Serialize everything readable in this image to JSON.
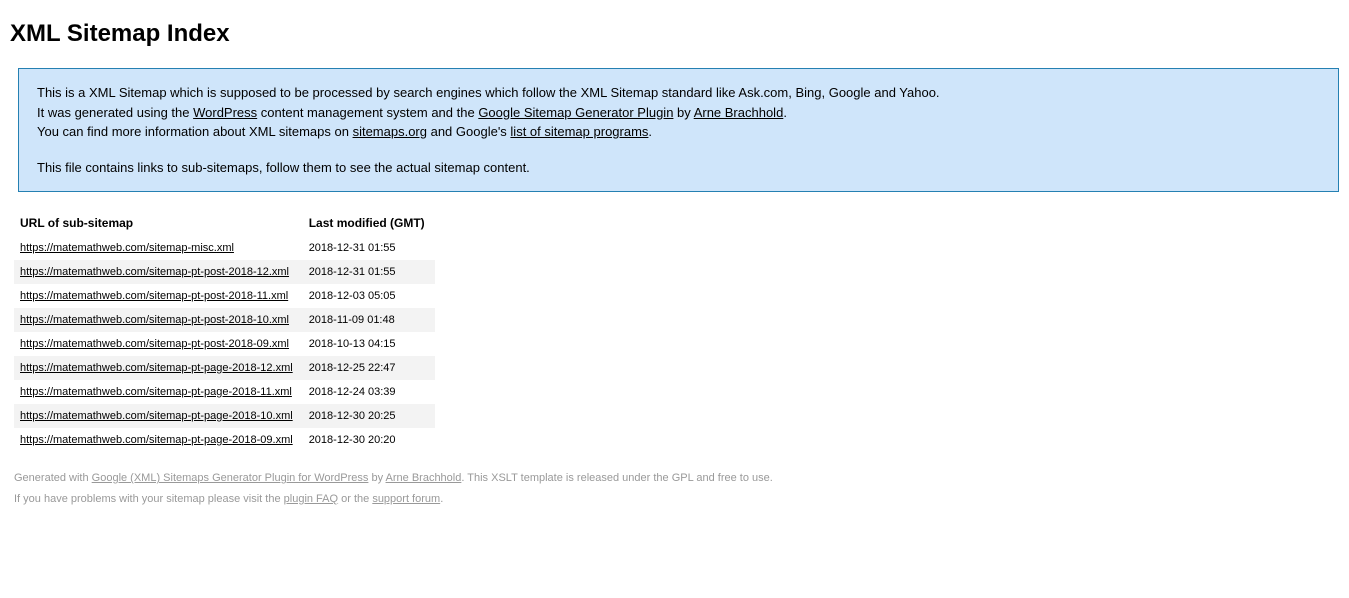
{
  "title": "XML Sitemap Index",
  "info": {
    "line1_pre": "This is a XML Sitemap which is supposed to be processed by search engines which follow the XML Sitemap standard like Ask.com, Bing, Google and Yahoo.",
    "line2_pre": "It was generated using the ",
    "link_wordpress": "WordPress",
    "line2_mid": " content management system and the ",
    "link_plugin": "Google Sitemap Generator Plugin",
    "line2_by": " by ",
    "link_author": "Arne Brachhold",
    "line2_end": ".",
    "line3_pre": "You can find more information about XML sitemaps on ",
    "link_sitemaps": "sitemaps.org",
    "line3_mid": " and Google's ",
    "link_programs": "list of sitemap programs",
    "line3_end": ".",
    "line4": "This file contains links to sub-sitemaps, follow them to see the actual sitemap content."
  },
  "table": {
    "col_url": "URL of sub-sitemap",
    "col_mod": "Last modified (GMT)",
    "rows": [
      {
        "url": "https://matemathweb.com/sitemap-misc.xml",
        "mod": "2018-12-31 01:55"
      },
      {
        "url": "https://matemathweb.com/sitemap-pt-post-2018-12.xml",
        "mod": "2018-12-31 01:55"
      },
      {
        "url": "https://matemathweb.com/sitemap-pt-post-2018-11.xml",
        "mod": "2018-12-03 05:05"
      },
      {
        "url": "https://matemathweb.com/sitemap-pt-post-2018-10.xml",
        "mod": "2018-11-09 01:48"
      },
      {
        "url": "https://matemathweb.com/sitemap-pt-post-2018-09.xml",
        "mod": "2018-10-13 04:15"
      },
      {
        "url": "https://matemathweb.com/sitemap-pt-page-2018-12.xml",
        "mod": "2018-12-25 22:47"
      },
      {
        "url": "https://matemathweb.com/sitemap-pt-page-2018-11.xml",
        "mod": "2018-12-24 03:39"
      },
      {
        "url": "https://matemathweb.com/sitemap-pt-page-2018-10.xml",
        "mod": "2018-12-30 20:25"
      },
      {
        "url": "https://matemathweb.com/sitemap-pt-page-2018-09.xml",
        "mod": "2018-12-30 20:20"
      }
    ]
  },
  "footer": {
    "gen_pre": "Generated with ",
    "gen_link": "Google (XML) Sitemaps Generator Plugin for WordPress",
    "gen_by": " by ",
    "gen_author": "Arne Brachhold",
    "gen_end": ". This XSLT template is released under the GPL and free to use.",
    "help_pre": "If you have problems with your sitemap please visit the ",
    "help_faq": "plugin FAQ",
    "help_or": " or the ",
    "help_forum": "support forum",
    "help_end": "."
  }
}
